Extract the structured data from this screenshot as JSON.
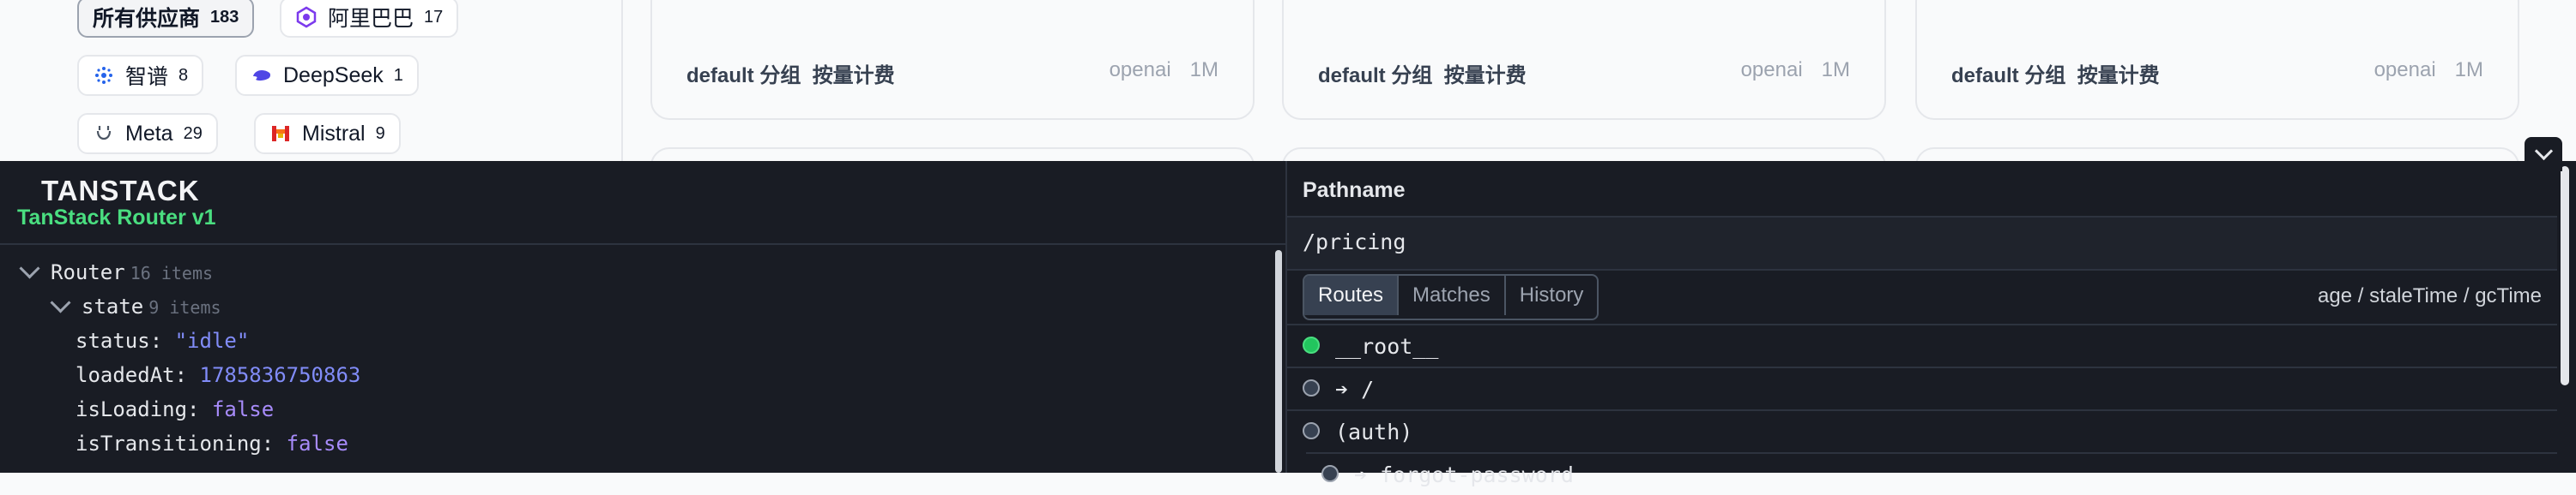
{
  "vendors": {
    "items": [
      {
        "label": "所有供应商",
        "count": "183"
      },
      {
        "label": "阿里巴巴",
        "count": "17"
      },
      {
        "label": "智谱",
        "count": "8"
      },
      {
        "label": "DeepSeek",
        "count": "1"
      },
      {
        "label": "Meta",
        "count": "29"
      },
      {
        "label": "Mistral",
        "count": "9"
      }
    ]
  },
  "cards": [
    {
      "group": "default 分组",
      "billing": "按量计费",
      "provider": "openai",
      "context": "1M"
    },
    {
      "group": "default 分组",
      "billing": "按量计费",
      "provider": "openai",
      "context": "1M"
    },
    {
      "group": "default 分组",
      "billing": "按量计费",
      "provider": "openai",
      "context": "1M"
    }
  ],
  "devtools": {
    "brand": "TANSTACK",
    "product": "TanStack Router v1",
    "tree": {
      "router_key": "Router",
      "router_meta": "16 items",
      "state_key": "state",
      "state_meta": "9 items",
      "status_key": "status:",
      "status_val": "\"idle\"",
      "loadedAt_key": "loadedAt:",
      "loadedAt_val": "1785836750863",
      "isLoading_key": "isLoading:",
      "isLoading_val": "false",
      "isTransitioning_key": "isTransitioning:",
      "isTransitioning_val": "false"
    },
    "pathname_label": "Pathname",
    "pathname": "/pricing",
    "tabs": [
      "Routes",
      "Matches",
      "History"
    ],
    "age_label": "age / staleTime / gcTime",
    "routes": [
      {
        "label": "__root__",
        "active": true
      },
      {
        "label": "➔ /",
        "active": false
      },
      {
        "label": "(auth)",
        "active": false
      },
      {
        "label": "➔ forgot-password",
        "active": false
      }
    ]
  },
  "colors": {
    "accent_green": "#4ade80",
    "value_purple": "#818cf8",
    "devtools_bg": "#191c24"
  }
}
